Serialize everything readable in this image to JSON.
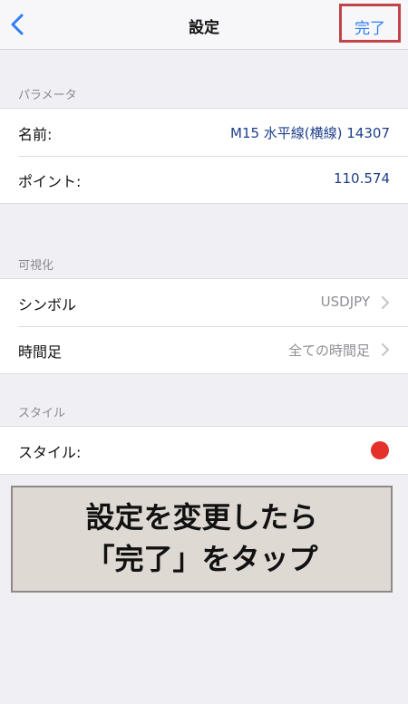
{
  "navbar": {
    "title": "設定",
    "back_icon": "chevron-left-icon",
    "done_label": "完了",
    "accent": "#2f7df5",
    "highlight_color": "#c0444a"
  },
  "sections": [
    {
      "header": "パラメータ",
      "rows": [
        {
          "label": "名前:",
          "value": "M15 水平線(横線) 14307"
        },
        {
          "label": "ポイント:",
          "value": "110.574"
        }
      ]
    },
    {
      "header": "可視化",
      "rows": [
        {
          "label": "シンボル",
          "value": "USDJPY"
        },
        {
          "label": "時間足",
          "value": "全ての時間足"
        }
      ]
    },
    {
      "header": "スタイル",
      "rows": [
        {
          "label": "スタイル:",
          "color": "#e4312b"
        }
      ]
    }
  ],
  "banner": {
    "line1": "設定を変更したら",
    "line2": "「完了」をタップ"
  }
}
